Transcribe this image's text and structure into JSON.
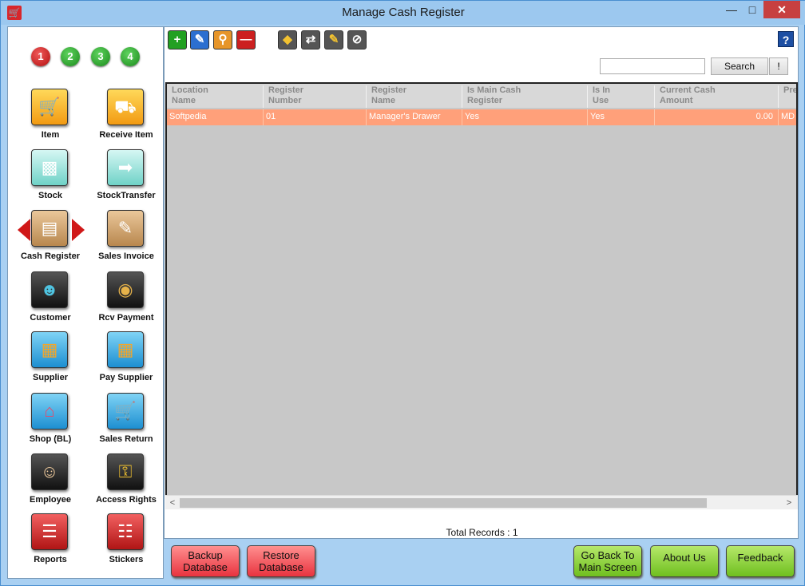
{
  "window": {
    "title": "Manage Cash Register"
  },
  "steps": [
    "1",
    "2",
    "3",
    "4"
  ],
  "nav": {
    "item": "Item",
    "receive_item": "Receive Item",
    "stock": "Stock",
    "stock_transfer": "StockTransfer",
    "cash_register": "Cash Register",
    "sales_invoice": "Sales Invoice",
    "customer": "Customer",
    "rcv_payment": "Rcv Payment",
    "supplier": "Supplier",
    "pay_supplier": "Pay Supplier",
    "shop": "Shop (BL)",
    "sales_return": "Sales Return",
    "employee": "Employee",
    "access_rights": "Access Rights",
    "reports": "Reports",
    "stickers": "Stickers"
  },
  "toolbar": {
    "help": "?"
  },
  "search": {
    "value": "",
    "button": "Search",
    "bang": "!"
  },
  "grid": {
    "columns": [
      "Location\nName",
      "Register\nNumber",
      "Register\nName",
      "Is Main Cash\nRegister",
      "Is In\nUse",
      "Current Cash\nAmount",
      "Pre"
    ],
    "rows": [
      [
        "Softpedia",
        "01",
        "Manager's Drawer",
        "Yes",
        "Yes",
        "0.00",
        "MD"
      ]
    ]
  },
  "scroll": {
    "left": "<",
    "right": ">"
  },
  "total": "Total Records : 1",
  "buttons": {
    "backup": "Backup Database",
    "restore": "Restore Database",
    "goback": "Go Back To Main Screen",
    "about": "About Us",
    "feedback": "Feedback"
  },
  "colors": {
    "selected_row": "#ffa07a",
    "accent_red": "#e8333f",
    "accent_green": "#6fbf1f"
  },
  "icons": {
    "toolbar": [
      "add-icon",
      "edit-icon",
      "search-icon",
      "delete-icon",
      "stack-icon",
      "transfer-icon",
      "note-icon",
      "cancel-icon"
    ]
  }
}
